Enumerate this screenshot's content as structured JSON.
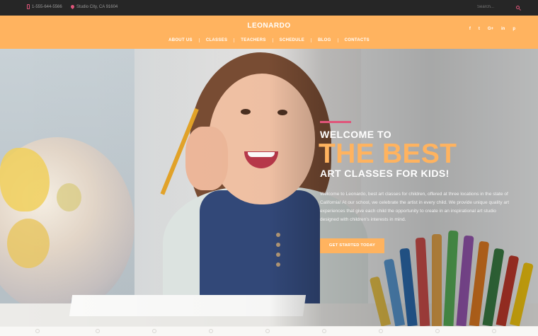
{
  "topbar": {
    "phone": "1-555-644-5566",
    "address": "Studio City, CA 91604",
    "search_placeholder": "Search..."
  },
  "header": {
    "logo": "LEONARDO",
    "nav": [
      "ABOUT US",
      "CLASSES",
      "TEACHERS",
      "SCHEDULE",
      "BLOG",
      "CONTACTS"
    ],
    "social": [
      {
        "icon": "facebook-icon",
        "glyph": "f"
      },
      {
        "icon": "twitter-icon",
        "glyph": "t"
      },
      {
        "icon": "google-plus-icon",
        "glyph": "G+"
      },
      {
        "icon": "linkedin-icon",
        "glyph": "in"
      },
      {
        "icon": "pinterest-icon",
        "glyph": "p"
      }
    ]
  },
  "hero": {
    "kicker": "WELCOME TO",
    "headline": "THE BEST",
    "subhead": "ART CLASSES FOR KIDS!",
    "body": "Welcome to Leonardo, best art classes for children, offered at three locations in the state of California! At our school, we celebrate the artist in every child. We provide unique quality art experiences that give each child the opportunity to create in an inspirational art studio designed with children's interests in mind.",
    "cta": "GET STARTED TODAY"
  },
  "colors": {
    "accent": "#ffb35f",
    "pink": "#e0557a",
    "topbar": "#262626"
  }
}
